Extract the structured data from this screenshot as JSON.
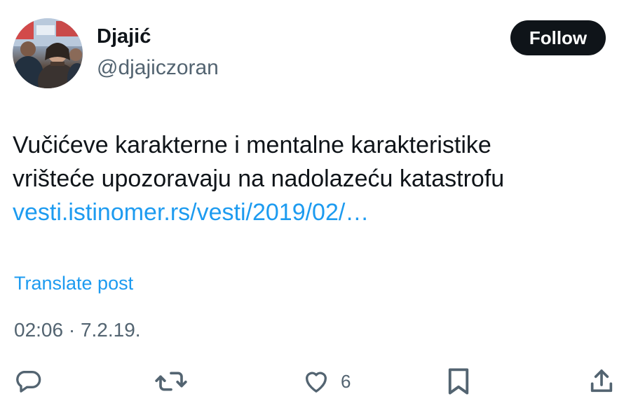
{
  "author": {
    "display_name": "Djajić",
    "handle": "@djajiczoran",
    "avatar_icon": "profile-photo"
  },
  "follow_button": {
    "label": "Follow"
  },
  "tweet": {
    "text_line_1": "Vučićeve karakterne i mentalne karakteristike",
    "text_line_2": "vrišteće upozoravaju na nadolazeću katastrofu",
    "link_text": "vesti.istinomer.rs/vesti/2019/02/…",
    "translate_label": "Translate post",
    "timestamp": "02:06 · 7.2.19."
  },
  "actions": {
    "reply_icon": "speech-bubble",
    "repost_icon": "repost-arrows",
    "like_icon": "heart",
    "like_count": "6",
    "bookmark_icon": "bookmark",
    "share_icon": "share-upload"
  },
  "colors": {
    "text": "#0f1419",
    "secondary": "#536471",
    "link": "#1d9bf0",
    "button_bg": "#0f1419"
  }
}
